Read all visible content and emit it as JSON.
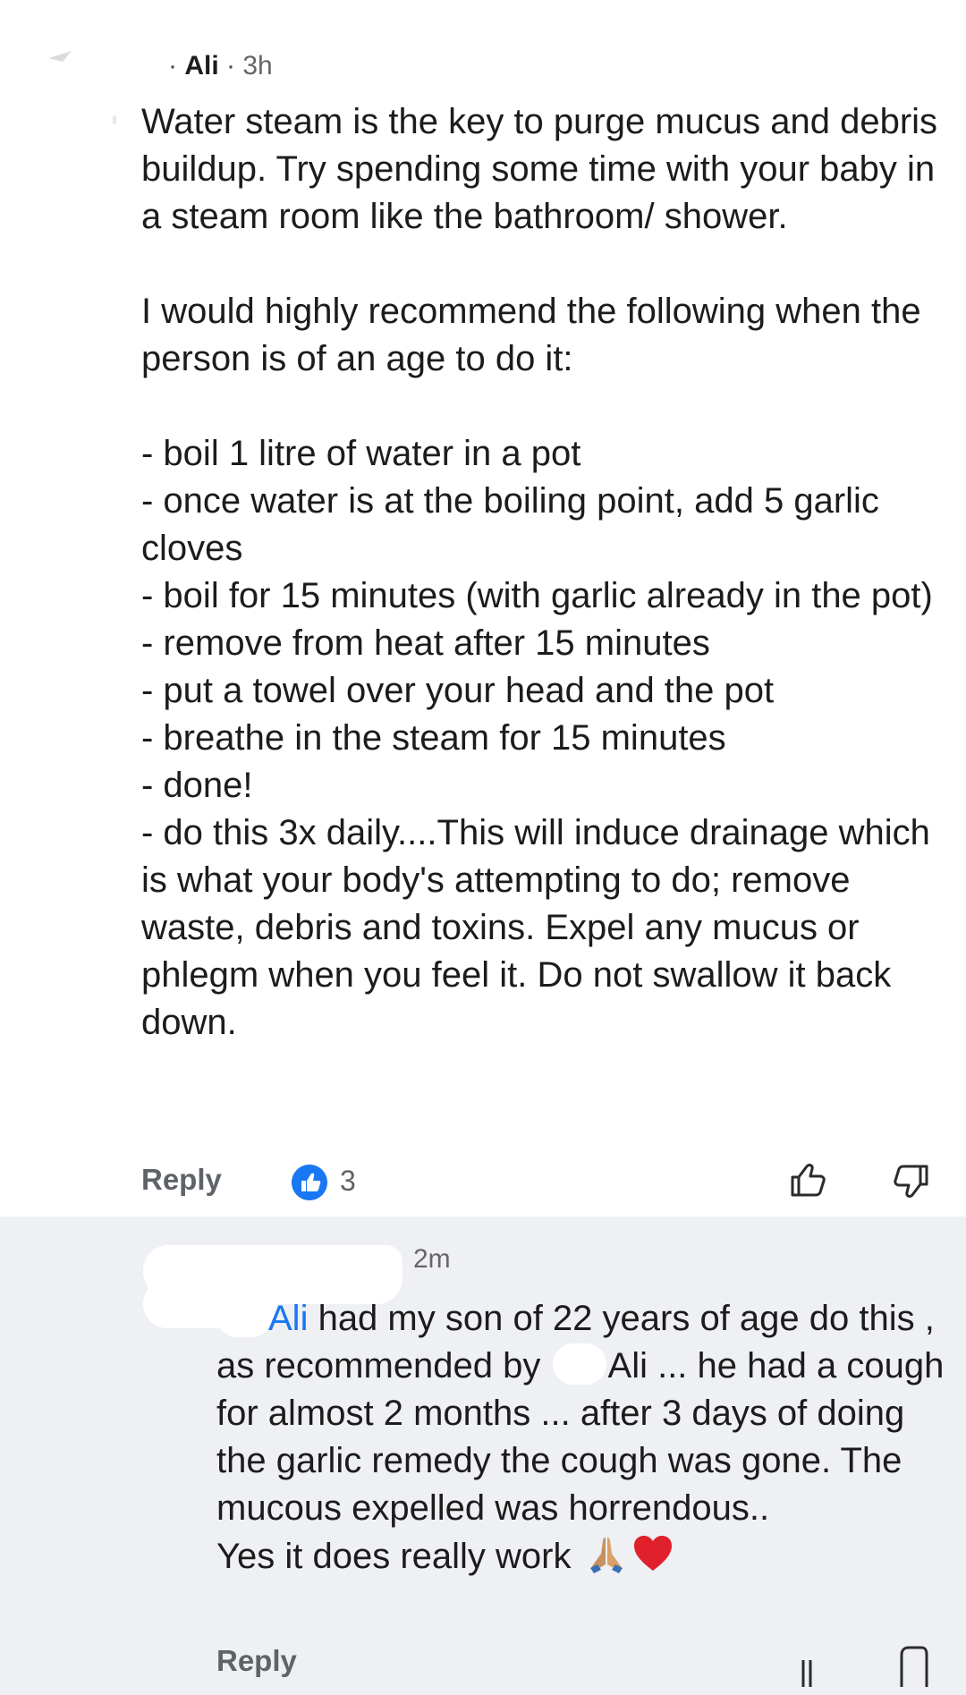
{
  "comment": {
    "author": "Ali",
    "separator_left": "·",
    "separator_mid": "·",
    "time": "3h",
    "body": [
      "Water steam is the key to purge mucus and debris buildup. Try spending some time with your baby in a steam room like the bathroom/ shower.",
      "",
      "I would highly recommend the following when the person is of an age to do it:",
      "",
      "- boil 1 litre of water in a pot",
      "- once water is at the boiling point, add 5 garlic cloves",
      "- boil for 15 minutes (with garlic already in the pot)",
      "- remove from heat after 15 minutes",
      "- put a towel over your head and the pot",
      "- breathe in the steam for 15 minutes",
      "- done!",
      "- do this 3x daily....This will induce drainage which is what your body's attempting to do; remove waste, debris and toxins. Expel any mucus or phlegm when you feel it. Do not swallow it back down."
    ],
    "reply_label": "Reply",
    "like_count": "3",
    "icons": {
      "like_badge": "like-badge-icon",
      "upvote": "thumbs-up-icon",
      "downvote": "thumbs-down-icon"
    },
    "colors": {
      "like_badge": "#1877f2",
      "action_text": "#5f6368"
    }
  },
  "reply": {
    "time": "2m",
    "mention": "Ali",
    "line1_rest": " had my son of 22 years of age do this , as recommended by ",
    "line1_name": "Ali",
    "line1_end": " ... he had a cough for almost 2 months ... after 3 days of doing the garlic remedy the cough was gone. The mucous expelled was horrendous..",
    "line2": "Yes it does really work",
    "reply_label": "Reply",
    "emoji": [
      "folded-hands-emoji",
      "red-heart-emoji"
    ],
    "colors": {
      "mention": "#1877f2",
      "background": "#eef0f3"
    }
  }
}
